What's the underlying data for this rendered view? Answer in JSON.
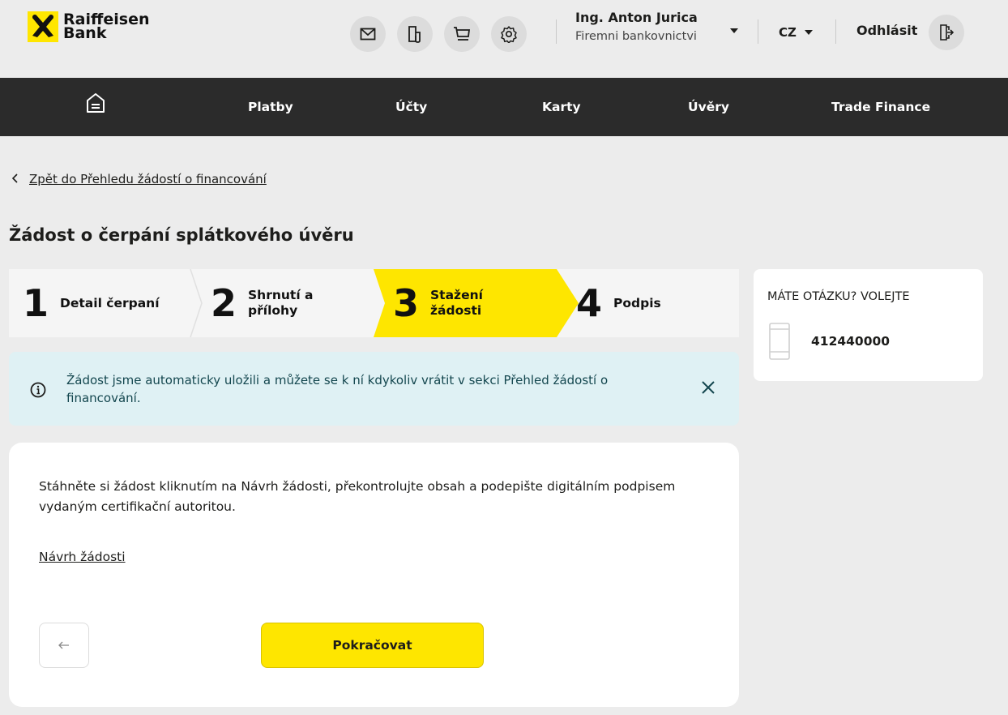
{
  "brand": {
    "line1": "Raiffeisen",
    "line2": "Bank",
    "accent": "#ffe600",
    "dark": "#2b2b2b"
  },
  "header": {
    "icons": [
      "mail-icon",
      "document-icon",
      "cart-icon",
      "settings-icon"
    ],
    "user_name": "Ing. Anton Jurica",
    "user_role": "Firemni bankovnictvi",
    "language": "CZ",
    "logout_label": "Odhlásit"
  },
  "nav": {
    "items": [
      {
        "label": "Platby"
      },
      {
        "label": "Účty"
      },
      {
        "label": "Karty"
      },
      {
        "label": "Úvěry"
      },
      {
        "label": "Trade Finance"
      }
    ]
  },
  "breadcrumb": {
    "back_label": "Zpět do Přehledu žádostí o financování"
  },
  "page_title": "Žádost o čerpání splátkového úvěru",
  "stepper": {
    "steps": [
      {
        "number": "1",
        "line1": "Detail čerpaní",
        "line2": ""
      },
      {
        "number": "2",
        "line1": "Shrnutí a",
        "line2": "přílohy"
      },
      {
        "number": "3",
        "line1": "Stažení",
        "line2": "žádosti"
      },
      {
        "number": "4",
        "line1": "Podpis",
        "line2": ""
      }
    ],
    "active_index": 2
  },
  "info": {
    "text": "Žádost jsme automaticky uložili a můžete se k ní kdykoliv vrátit v sekci  Přehled žádostí o financování."
  },
  "content": {
    "instructions": "Stáhněte si žádost kliknutím na Návrh žádosti, překontrolujte obsah a podepište digitálním podpisem vydaným certifikační autoritou.",
    "draft_link": "Návrh žádosti",
    "continue_label": "Pokračovat"
  },
  "sidebar": {
    "title": "MÁTE OTÁZKU? VOLEJTE",
    "phone": "412440000"
  }
}
